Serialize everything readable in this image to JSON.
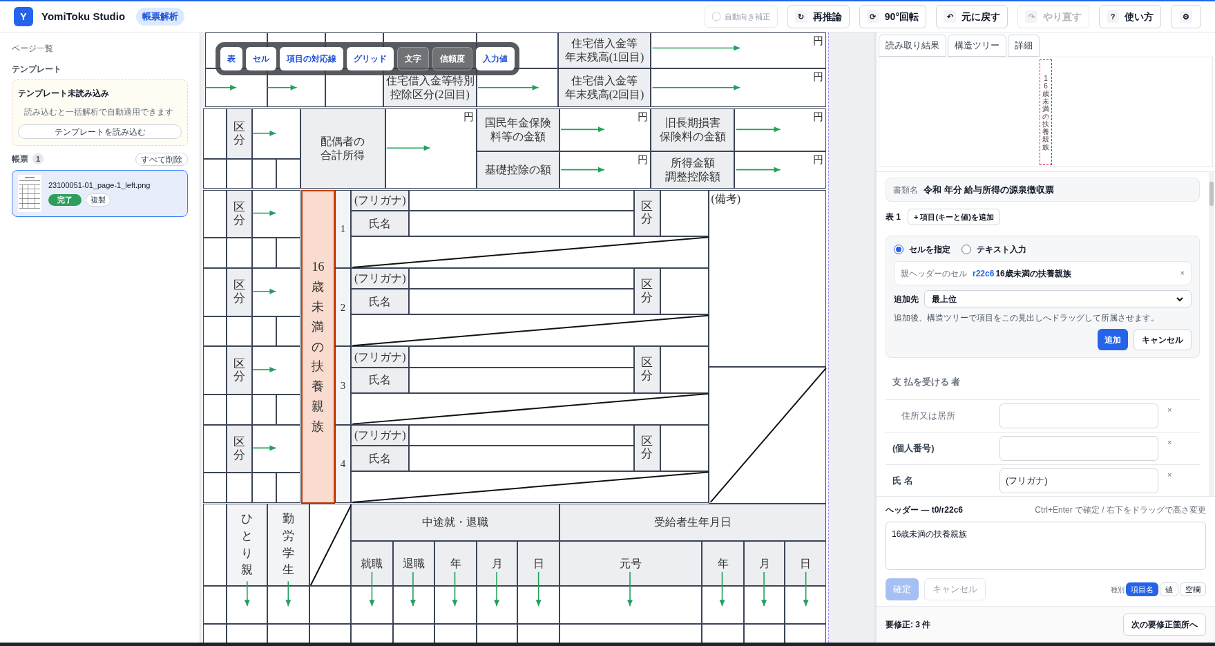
{
  "header": {
    "logo": "Y",
    "app_name": "YomiToku Studio",
    "mode_badge": "帳票解析",
    "auto_rotate": {
      "label": "自動向き補正",
      "checked": false,
      "disabled": true
    },
    "actions": [
      {
        "icon": "↻",
        "label": "再推論",
        "disabled": false
      },
      {
        "icon": "⟳",
        "label": "90°回転",
        "disabled": false
      },
      {
        "icon": "↶",
        "label": "元に戻す",
        "disabled": false
      },
      {
        "icon": "↷",
        "label": "やり直す",
        "disabled": true
      },
      {
        "icon": "?",
        "label": "使い方",
        "disabled": false
      },
      {
        "icon": "⚙",
        "disabled": false
      }
    ]
  },
  "sidebar": {
    "title": "ページ一覧",
    "template_heading": "テンプレート",
    "template_card": {
      "title": "テンプレート未読み込み",
      "description": "読み込むと一括解析で自動適用できます",
      "button": "テンプレートを読み込む"
    },
    "forms_heading": "帳票",
    "forms_count": "1",
    "delete_all": "すべて削除",
    "files": [
      {
        "name": "23100051-01_page-1_left.png",
        "status": "完了",
        "duplicate": "複製",
        "selected": true
      }
    ]
  },
  "viewer": {
    "toolbar": [
      {
        "label": "表",
        "selected": true
      },
      {
        "label": "セル",
        "selected": true
      },
      {
        "label": "項目の対応線",
        "selected": true
      },
      {
        "label": "グリッド",
        "selected": true
      },
      {
        "label": "文字",
        "selected": false
      },
      {
        "label": "信頼度",
        "selected": false
      },
      {
        "label": "入力値",
        "selected": true
      }
    ],
    "cells": [
      {
        "kind": "label",
        "lines": [
          "住宅借入金等",
          "年末残高(1回目)"
        ]
      },
      {
        "kind": "amount",
        "text": "円"
      },
      {
        "kind": "label",
        "lines": [
          "住宅借入金等特別",
          "控除区分(2回目)"
        ]
      },
      {
        "kind": "label",
        "lines": [
          "住宅借入金等",
          "年末残高(2回目)"
        ]
      },
      {
        "kind": "amount",
        "text": "円"
      },
      {
        "kind": "vlabel",
        "text": "区分"
      },
      {
        "kind": "label",
        "lines": [
          "配偶者の",
          "合計所得"
        ]
      },
      {
        "kind": "amount",
        "text": "円"
      },
      {
        "kind": "label",
        "lines": [
          "国民年金保険",
          "料等の金額"
        ]
      },
      {
        "kind": "amount",
        "text": "円"
      },
      {
        "kind": "label",
        "lines": [
          "旧長期損害",
          "保険料の金額"
        ]
      },
      {
        "kind": "amount",
        "text": "円"
      },
      {
        "kind": "label",
        "text": "基礎控除の額"
      },
      {
        "kind": "amount",
        "text": "円"
      },
      {
        "kind": "label",
        "lines": [
          "所得金額",
          "調整控除額"
        ]
      },
      {
        "kind": "amount",
        "text": "円"
      },
      {
        "kind": "highlight",
        "text": "16歳未満の扶養親族"
      },
      {
        "kind": "vlabel",
        "text": "区分"
      },
      {
        "kind": "number",
        "text": "1"
      },
      {
        "kind": "label",
        "text": "(フリガナ)"
      },
      {
        "kind": "label",
        "text": "氏名"
      },
      {
        "kind": "vlabel",
        "text": "区分"
      },
      {
        "kind": "vlabel",
        "text": "区分"
      },
      {
        "kind": "number",
        "text": "2"
      },
      {
        "kind": "label",
        "text": "(フリガナ)"
      },
      {
        "kind": "label",
        "text": "氏名"
      },
      {
        "kind": "vlabel",
        "text": "区分"
      },
      {
        "kind": "vlabel",
        "text": "区分"
      },
      {
        "kind": "number",
        "text": "3"
      },
      {
        "kind": "label",
        "text": "(フリガナ)"
      },
      {
        "kind": "label",
        "text": "氏名"
      },
      {
        "kind": "vlabel",
        "text": "区分"
      },
      {
        "kind": "vlabel",
        "text": "区分"
      },
      {
        "kind": "number",
        "text": "4"
      },
      {
        "kind": "label",
        "text": "(フリガナ)"
      },
      {
        "kind": "label",
        "text": "氏名"
      },
      {
        "kind": "vlabel",
        "text": "区分"
      },
      {
        "kind": "note",
        "text": "(備考)"
      },
      {
        "kind": "vspread",
        "text": "ひとり親"
      },
      {
        "kind": "vspread",
        "text": "勤労学生"
      },
      {
        "kind": "label",
        "text": "中途就・退職"
      },
      {
        "kind": "label",
        "text": "受給者生年月日"
      },
      {
        "kind": "label",
        "text": "就職"
      },
      {
        "kind": "label",
        "text": "退職"
      },
      {
        "kind": "label",
        "text": "年"
      },
      {
        "kind": "label",
        "text": "月"
      },
      {
        "kind": "label",
        "text": "日"
      },
      {
        "kind": "label",
        "text": "元号"
      },
      {
        "kind": "label",
        "text": "年"
      },
      {
        "kind": "label",
        "text": "月"
      },
      {
        "kind": "label",
        "text": "日"
      }
    ]
  },
  "right_panel": {
    "tabs": [
      {
        "label": "読み取り結果",
        "selected": false
      },
      {
        "label": "構造ツリー",
        "selected": false
      },
      {
        "label": "詳細",
        "selected": false
      }
    ],
    "preview_text": "16歳未満の扶養親族",
    "doc_name": {
      "label": "書類名",
      "value": "令和 年分 給与所得の源泉徴収票"
    },
    "table_label": "表 1",
    "add_item": "+ 項目(キーと値)を追加",
    "add_form": {
      "modes": [
        {
          "label": "セルを指定",
          "selected": true
        },
        {
          "label": "テキスト入力",
          "selected": false
        }
      ],
      "parent_label": "親ヘッダーのセル",
      "parent_ref": "r22c6",
      "parent_text": "16歳未満の扶養親族",
      "clear": "×",
      "target_label": "追加先",
      "target_value": "最上位",
      "hint": "追加後、構造ツリーで項目をこの見出しへドラッグして所属させます。",
      "submit": "追加",
      "cancel": "キャンセル"
    },
    "section": "支 払を受ける 者",
    "fields": [
      {
        "kind": "indented",
        "label": "住所又は居所",
        "remove": "×"
      },
      {
        "kind": "plain",
        "label": "(個人番号)",
        "remove": "×"
      },
      {
        "kind": "plain",
        "label": "氏 名",
        "value": "(フリガナ)",
        "remove": "×"
      }
    ]
  },
  "editor": {
    "title": "ヘッダー — t0/r22c6",
    "hint": "Ctrl+Enter で確定 / 右下をドラッグで高さ変更",
    "value": "16歳未満の扶養親族",
    "confirm": {
      "label": "確定",
      "disabled": true
    },
    "cancel": "キャンセル",
    "type_label": "種別",
    "types": [
      {
        "label": "項目名",
        "selected": true
      },
      {
        "label": "値",
        "selected": false
      },
      {
        "label": "空欄",
        "selected": false
      }
    ]
  },
  "footer": {
    "count": "要修正: 3 件",
    "next": "次の要修正箇所へ"
  }
}
